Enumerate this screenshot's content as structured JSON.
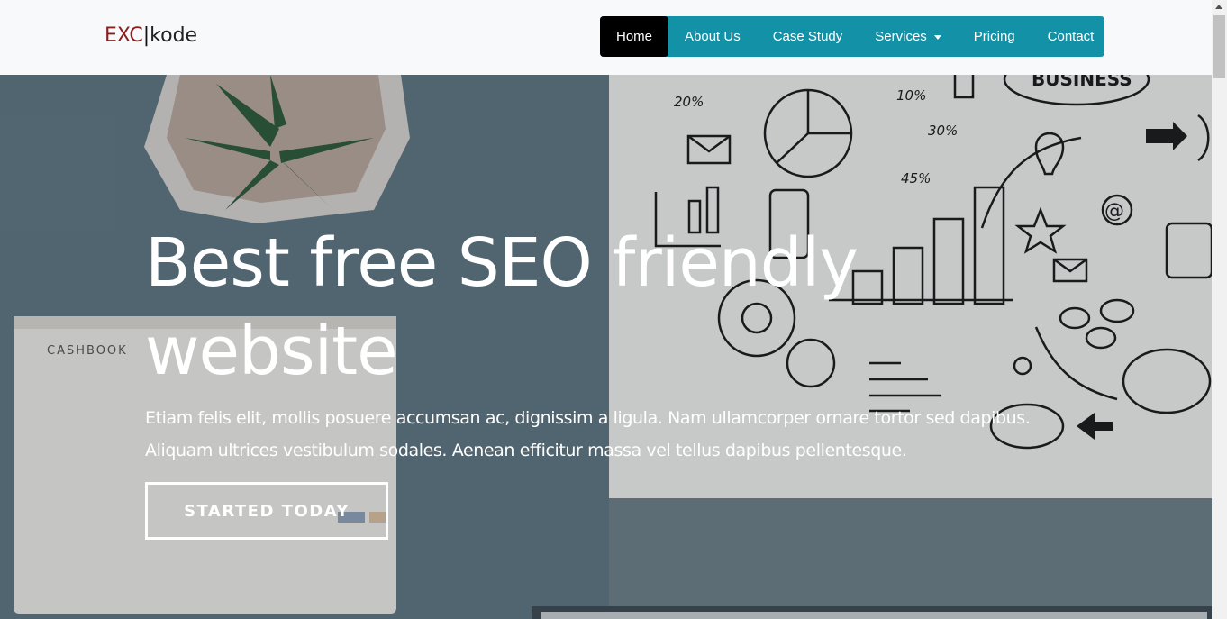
{
  "brand": {
    "accent": "EXC",
    "separator": "|",
    "rest": "kode"
  },
  "nav": {
    "items": [
      {
        "label": "Home",
        "active": true
      },
      {
        "label": "About Us"
      },
      {
        "label": "Case Study"
      },
      {
        "label": "Services",
        "dropdown": true
      },
      {
        "label": "Pricing"
      },
      {
        "label": "Contact"
      }
    ]
  },
  "hero": {
    "title": "Best free SEO friendly website",
    "text": "Etiam felis elit, mollis posuere accumsan ac, dignissim a ligula. Nam ullamcorper ornare tortor sed dapibus. Aliquam ultrices vestibulum sodales. Aenean efficitur massa vel tellus dapibus pellentesque.",
    "cta": "STARTED TODAY",
    "photo_text": {
      "book": "CASHBOOK",
      "board_word": "BUSINESS",
      "pct_20": "20%",
      "pct_10": "10%",
      "pct_30": "30%",
      "pct_45": "45%",
      "at": "@"
    }
  },
  "colors": {
    "brand_accent": "#8b1e1e",
    "nav_bg": "#1391a7",
    "nav_active": "#000000",
    "navbar_bg": "#f8f9fa"
  }
}
